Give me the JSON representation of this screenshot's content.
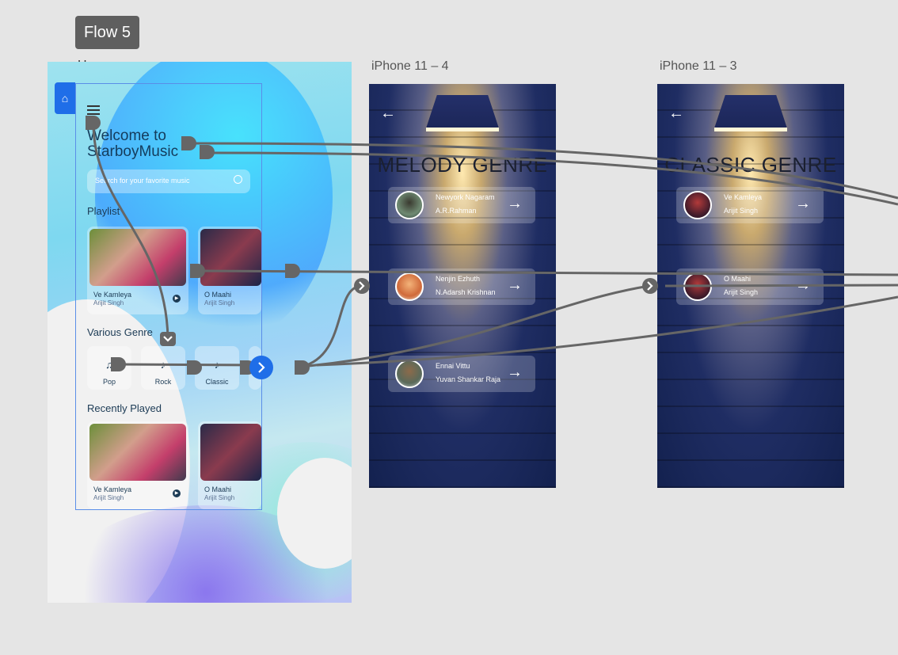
{
  "flow_badge": "Flow 5",
  "artboards": {
    "home": "Home",
    "iphone4": "iPhone 11 – 4",
    "iphone3": "iPhone 11 – 3"
  },
  "home": {
    "welcome_line1": "Welcome to",
    "welcome_line2": "StarboyMusic",
    "search_placeholder": "Search for your favorite music",
    "playlist_title": "Playlist",
    "genre_title": "Various Genre",
    "recent_title": "Recently Played",
    "playlist": [
      {
        "title": "Ve Kamleya",
        "artist": "Arijit Singh"
      },
      {
        "title": "O Maahi",
        "artist": "Arijit Singh"
      }
    ],
    "genres": [
      {
        "label": "Pop",
        "note": "♫"
      },
      {
        "label": "Rock",
        "note": "♪"
      },
      {
        "label": "Classic",
        "note": "♪"
      }
    ],
    "recent": [
      {
        "title": "Ve Kamleya",
        "artist": "Arijit Singh"
      },
      {
        "title": "O Maahi",
        "artist": "Arijit Singh"
      }
    ]
  },
  "iphone4": {
    "heading": "MELODY GENRE",
    "songs": [
      {
        "title": "Newyork Nagaram",
        "artist": "A.R.Rahman"
      },
      {
        "title": "Nenjin Ezhuth",
        "artist": "N.Adarsh Krishnan"
      },
      {
        "title": "Ennai Vittu",
        "artist": "Yuvan Shankar Raja"
      }
    ]
  },
  "iphone3": {
    "heading": "CLASSIC GENRE",
    "songs": [
      {
        "title": "Ve Kamleya",
        "artist": "Arijit Singh"
      },
      {
        "title": "O Maahi",
        "artist": "Arijit Singh"
      }
    ]
  },
  "icons": {
    "home": "home-icon",
    "menu": "hamburger-icon",
    "search": "search-icon",
    "back": "back-arrow-icon",
    "forward": "right-arrow-icon",
    "play": "play-icon"
  },
  "colors": {
    "canvas": "#e5e5e5",
    "badge": "#5f5f5f",
    "wire": "#666666",
    "accent": "#1f6ee8"
  }
}
